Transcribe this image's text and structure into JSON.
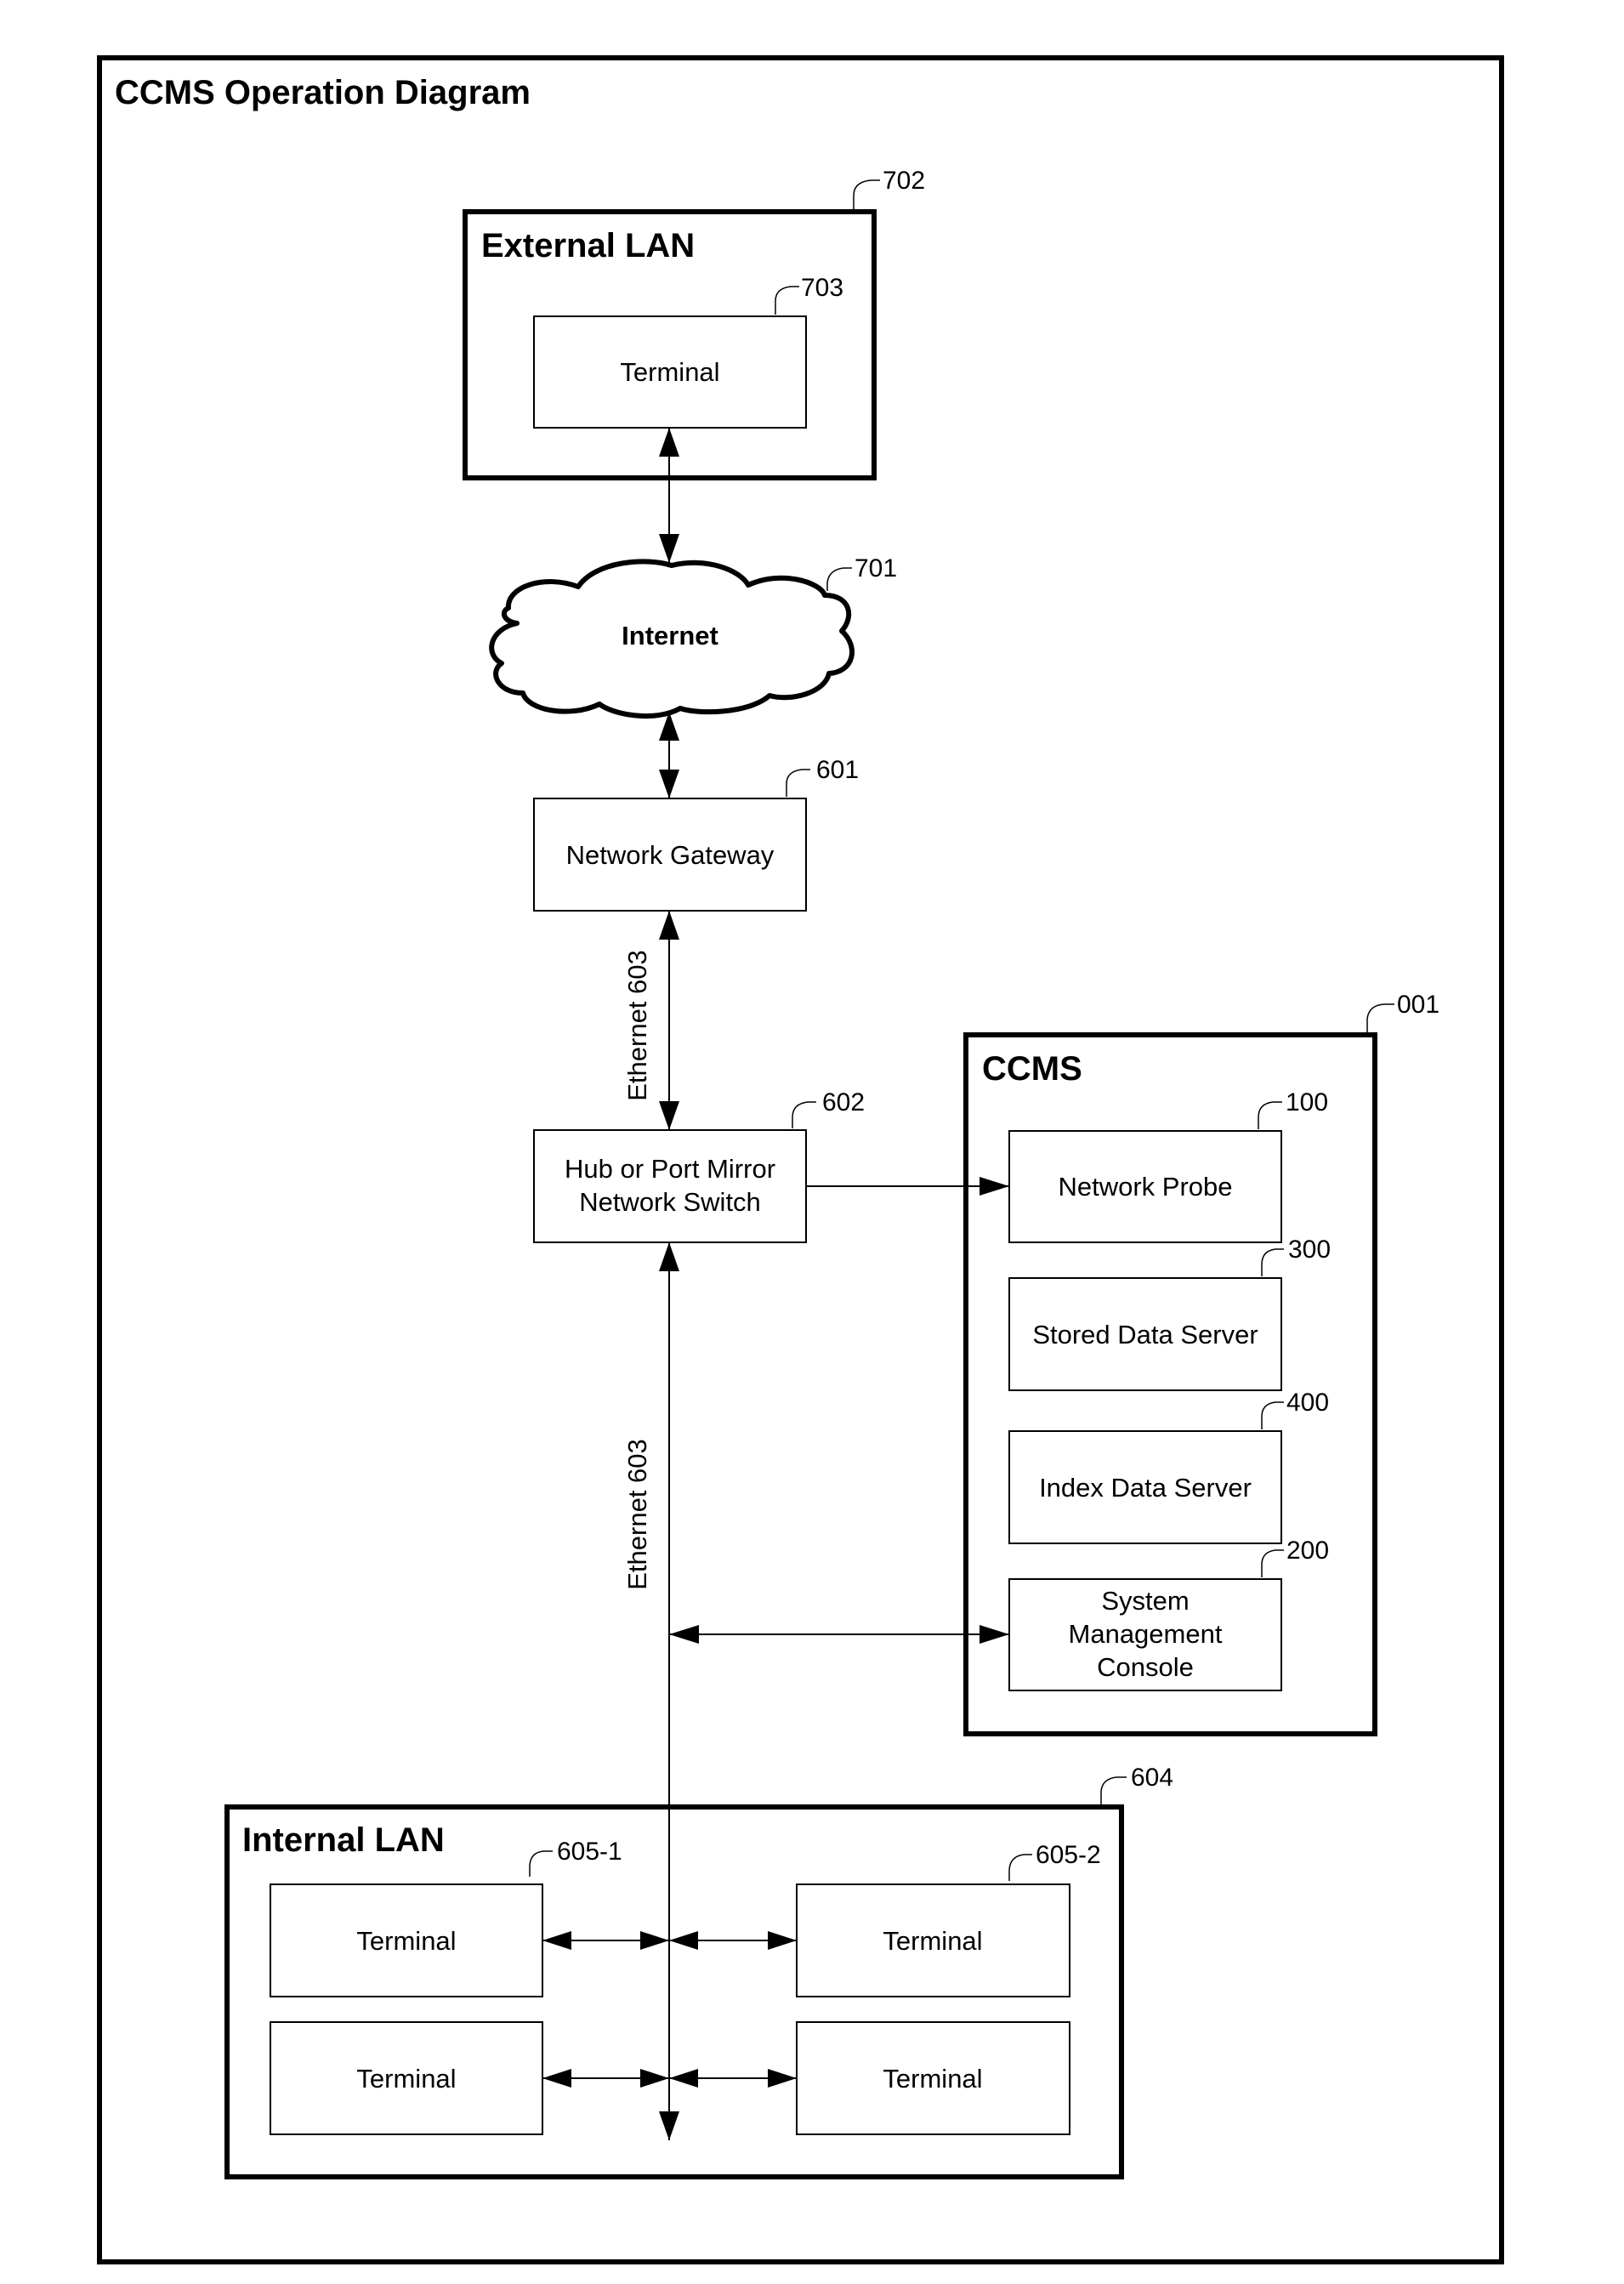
{
  "diagram": {
    "title": "CCMS Operation Diagram",
    "external_lan": {
      "title": "External LAN",
      "ref": "702",
      "terminal": {
        "label": "Terminal",
        "ref": "703"
      }
    },
    "internet": {
      "label": "Internet",
      "ref": "701"
    },
    "gateway": {
      "label": "Network Gateway",
      "ref": "601"
    },
    "hub": {
      "line1": "Hub or Port Mirror",
      "line2": "Network Switch",
      "ref": "602"
    },
    "ethernet_label": "Ethernet 603",
    "ccms": {
      "title": "CCMS",
      "ref": "001",
      "components": [
        {
          "lines": [
            "Network Probe"
          ],
          "ref": "100"
        },
        {
          "lines": [
            "Stored Data Server"
          ],
          "ref": "300"
        },
        {
          "lines": [
            "Index Data Server"
          ],
          "ref": "400"
        },
        {
          "lines": [
            "System",
            "Management",
            "Console"
          ],
          "ref": "200"
        }
      ]
    },
    "internal_lan": {
      "title": "Internal LAN",
      "ref": "604",
      "terminals": [
        {
          "label": "Terminal",
          "ref": "605-1"
        },
        {
          "label": "Terminal",
          "ref": "605-2"
        },
        {
          "label": "Terminal",
          "ref": ""
        },
        {
          "label": "Terminal",
          "ref": ""
        }
      ]
    },
    "connections": [
      {
        "from": "Terminal 703",
        "to": "Internet 701",
        "type": "bidirectional"
      },
      {
        "from": "Internet 701",
        "to": "Network Gateway 601",
        "type": "bidirectional"
      },
      {
        "from": "Network Gateway 601",
        "to": "Hub or Port Mirror Network Switch 602",
        "type": "bidirectional",
        "label": "Ethernet 603"
      },
      {
        "from": "Hub or Port Mirror Network Switch 602",
        "to": "Network Probe 100",
        "type": "directed"
      },
      {
        "from": "Internal LAN 604",
        "to": "Hub or Port Mirror Network Switch 602",
        "type": "bidirectional",
        "label": "Ethernet 603"
      },
      {
        "from": "Ethernet 603",
        "to": "System Management Console 200",
        "type": "bidirectional"
      },
      {
        "from": "Terminal 605-1",
        "to": "Ethernet 603",
        "type": "bidirectional"
      },
      {
        "from": "Terminal 605-2",
        "to": "Ethernet 603",
        "type": "bidirectional"
      },
      {
        "from": "Terminal",
        "to": "Ethernet 603",
        "type": "bidirectional"
      },
      {
        "from": "Terminal",
        "to": "Ethernet 603",
        "type": "bidirectional"
      }
    ]
  }
}
